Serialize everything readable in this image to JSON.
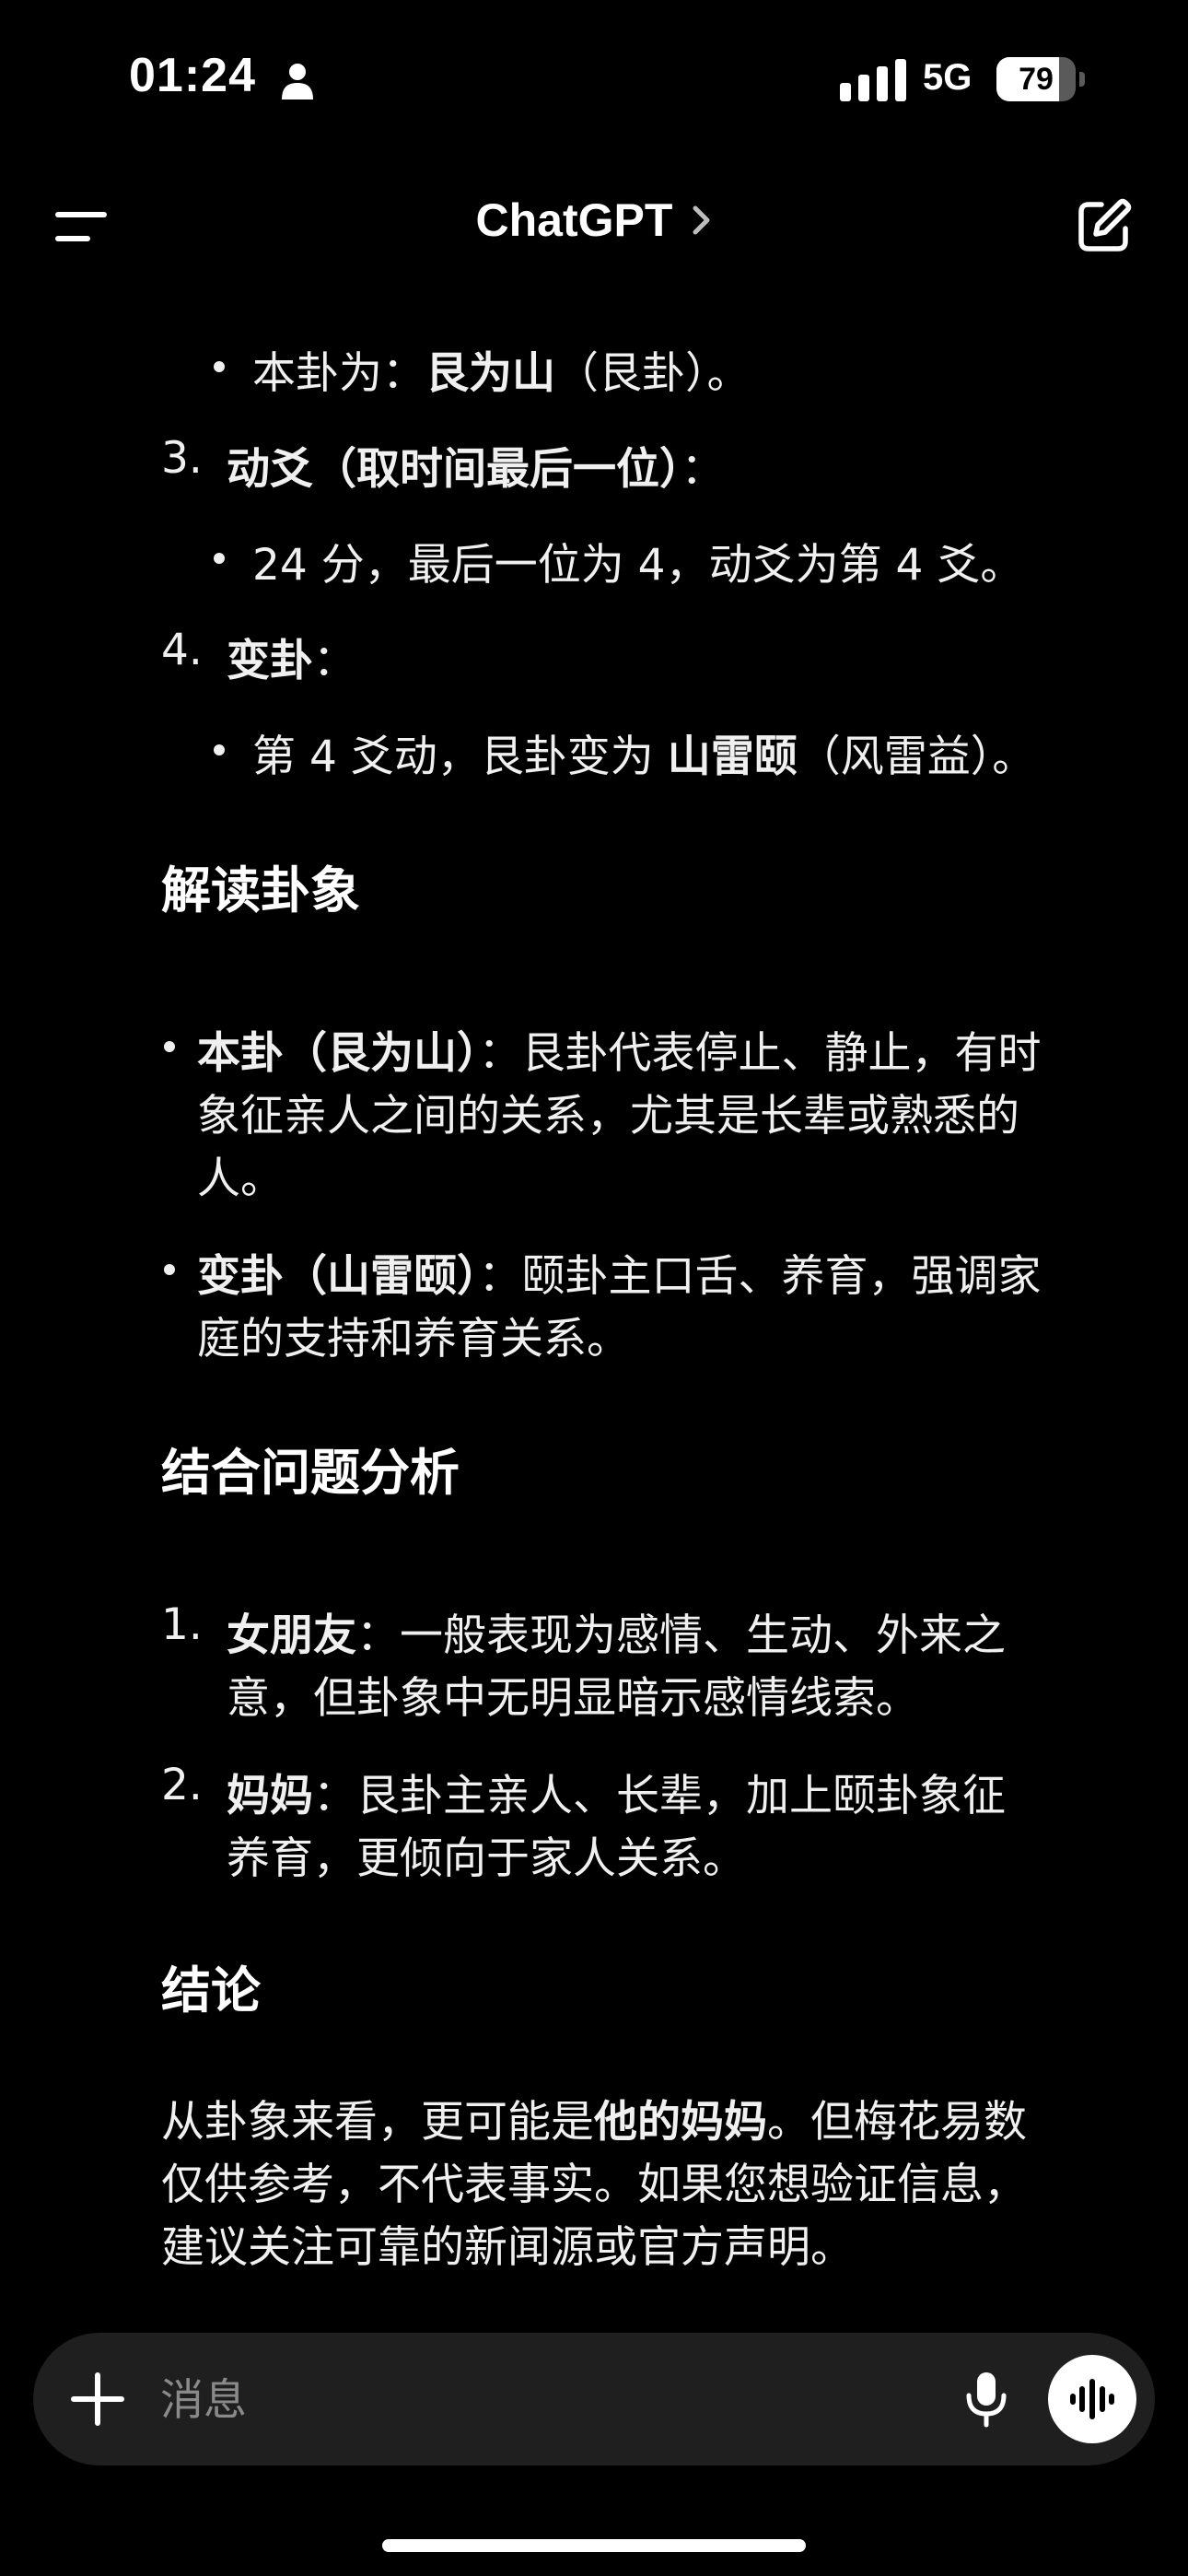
{
  "status_bar": {
    "time": "01:24",
    "network": "5G",
    "battery": 79
  },
  "nav": {
    "title": "ChatGPT"
  },
  "content": {
    "step2_bullet": {
      "prefix": "本卦为：",
      "bold": "艮为山",
      "suffix": "（艮卦）。"
    },
    "step3": {
      "number": "3.",
      "bold": "动爻（取时间最后一位）",
      "suffix": "："
    },
    "step3_bullet": {
      "text": "24 分，最后一位为 4，动爻为第 4 爻。"
    },
    "step4": {
      "number": "4.",
      "bold": "变卦",
      "suffix": "："
    },
    "step4_bullet": {
      "prefix": "第 4 爻动，艮卦变为 ",
      "bold": "山雷颐",
      "suffix": "（风雷益）。"
    },
    "section_interpret": "解读卦象",
    "interpret_1": {
      "bold": "本卦（艮为山）",
      "line1": "：艮卦代表停止、静止，有时",
      "line2": "象征亲人之间的关系，尤其是长辈或熟悉的",
      "line3": "人。"
    },
    "interpret_2": {
      "bold": "变卦（山雷颐）",
      "line1": "：颐卦主口舌、养育，强调家",
      "line2": "庭的支持和养育关系。"
    },
    "section_analysis": "结合问题分析",
    "analysis_1": {
      "number": "1.",
      "bold": "女朋友",
      "line1": "：一般表现为感情、生动、外来之",
      "line2": "意，但卦象中无明显暗示感情线索。"
    },
    "analysis_2": {
      "number": "2.",
      "bold": "妈妈",
      "line1": "：艮卦主亲人、长辈，加上颐卦象征",
      "line2": "养育，更倾向于家人关系。"
    },
    "section_conclusion": "结论",
    "conclusion": {
      "prefix": "从卦象来看，更可能是",
      "bold": "他的妈妈",
      "line1_suffix": "。但梅花易数",
      "line2": "仅供参考，不代表事实。如果您想验证信息，",
      "line3": "建议关注可靠的新闻源或官方声明。"
    }
  },
  "composer": {
    "placeholder": "消息"
  },
  "colors": {
    "background": "#000000",
    "composer_bg": "#1f1f1f",
    "text": "#f0f0f0",
    "placeholder": "#8a8a8a"
  }
}
